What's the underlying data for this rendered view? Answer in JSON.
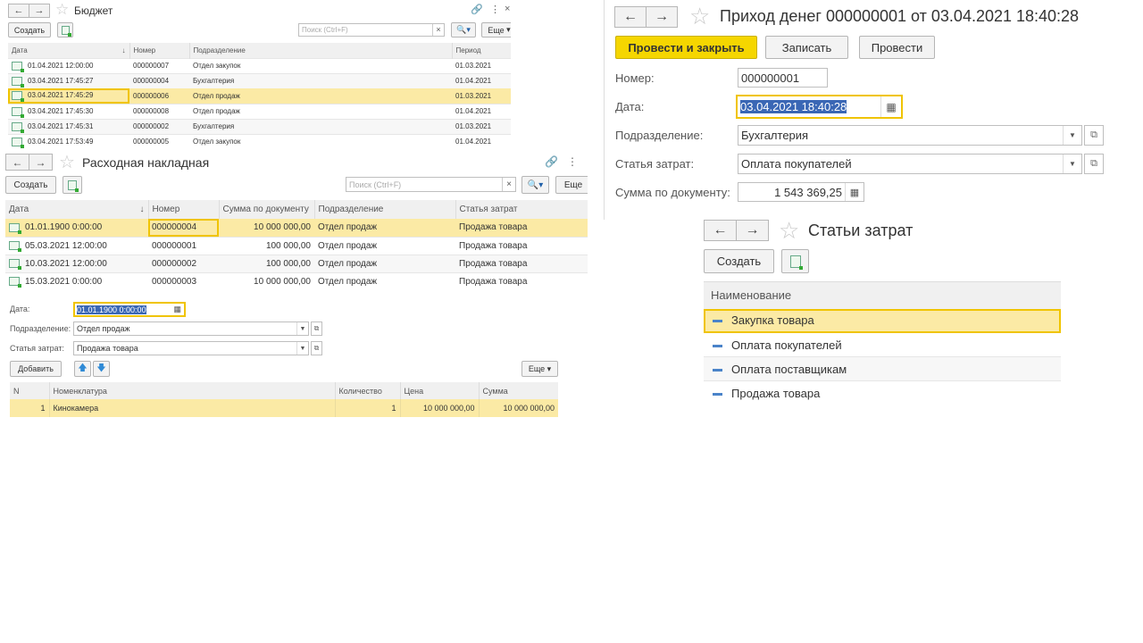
{
  "budget": {
    "title": "Бюджет",
    "create_label": "Создать",
    "search_placeholder": "Поиск (Ctrl+F)",
    "more_label": "Еще",
    "headers": [
      "Дата",
      "Номер",
      "Подразделение",
      "Период"
    ],
    "rows": [
      {
        "date": "01.04.2021 12:00:00",
        "number": "000000007",
        "dept": "Отдел закупок",
        "period": "01.03.2021"
      },
      {
        "date": "03.04.2021 17:45:27",
        "number": "000000004",
        "dept": "Бухгалтерия",
        "period": "01.04.2021"
      },
      {
        "date": "03.04.2021 17:45:29",
        "number": "000000006",
        "dept": "Отдел продаж",
        "period": "01.03.2021"
      },
      {
        "date": "03.04.2021 17:45:30",
        "number": "000000008",
        "dept": "Отдел продаж",
        "period": "01.04.2021"
      },
      {
        "date": "03.04.2021 17:45:31",
        "number": "000000002",
        "dept": "Бухгалтерия",
        "period": "01.03.2021"
      },
      {
        "date": "03.04.2021 17:53:49",
        "number": "000000005",
        "dept": "Отдел закупок",
        "period": "01.04.2021"
      }
    ]
  },
  "expense": {
    "title": "Расходная накладная",
    "create_label": "Создать",
    "search_placeholder": "Поиск (Ctrl+F)",
    "more_label": "Еще",
    "headers": [
      "Дата",
      "Номер",
      "Сумма по документу",
      "Подразделение",
      "Статья затрат"
    ],
    "rows": [
      {
        "date": "01.01.1900 0:00:00",
        "number": "000000004",
        "sum": "10 000 000,00",
        "dept": "Отдел продаж",
        "item": "Продажа товара"
      },
      {
        "date": "05.03.2021 12:00:00",
        "number": "000000001",
        "sum": "100 000,00",
        "dept": "Отдел продаж",
        "item": "Продажа товара"
      },
      {
        "date": "10.03.2021 12:00:00",
        "number": "000000002",
        "sum": "100 000,00",
        "dept": "Отдел продаж",
        "item": "Продажа товара"
      },
      {
        "date": "15.03.2021 0:00:00",
        "number": "000000003",
        "sum": "10 000 000,00",
        "dept": "Отдел продаж",
        "item": "Продажа товара"
      }
    ],
    "form": {
      "date_label": "Дата:",
      "date_value": "01.01.1900  0:00:00",
      "dept_label": "Подразделение:",
      "dept_value": "Отдел продаж",
      "item_label": "Статья затрат:",
      "item_value": "Продажа товара",
      "add_label": "Добавить",
      "more_label": "Еще"
    },
    "lines_headers": [
      "N",
      "Номенклатура",
      "Количество",
      "Цена",
      "Сумма"
    ],
    "lines": [
      {
        "n": "1",
        "product": "Кинокамера",
        "qty": "1",
        "price": "10 000 000,00",
        "sum": "10 000 000,00"
      }
    ]
  },
  "income": {
    "title": "Приход денег 000000001 от 03.04.2021 18:40:28",
    "post_close_label": "Провести и закрыть",
    "save_label": "Записать",
    "post_label": "Провести",
    "number_label": "Номер:",
    "number_value": "000000001",
    "date_label": "Дата:",
    "date_value": "03.04.2021 18:40:28",
    "dept_label": "Подразделение:",
    "dept_value": "Бухгалтерия",
    "item_label": "Статья затрат:",
    "item_value": "Оплата покупателей",
    "sum_label": "Сумма по документу:",
    "sum_value": "1 543 369,25"
  },
  "cost_items": {
    "title": "Статьи затрат",
    "create_label": "Создать",
    "header": "Наименование",
    "rows": [
      "Закупка товара",
      "Оплата покупателей",
      "Оплата поставщикам",
      "Продажа товара"
    ]
  },
  "colors": {
    "selection": "#fbeaa5",
    "accent_yellow": "#f5d600",
    "focus_border": "#f0c400"
  }
}
